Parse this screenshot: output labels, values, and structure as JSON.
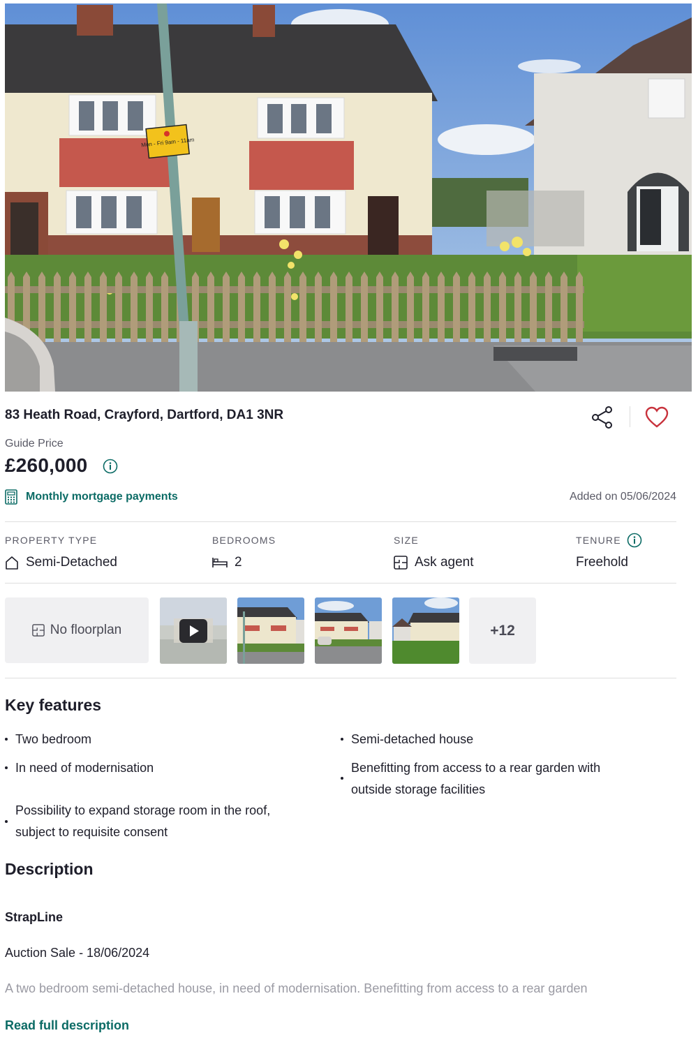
{
  "listing": {
    "address": "83 Heath Road, Crayford, Dartford, DA1 3NR",
    "price_label": "Guide Price",
    "price": "£260,000",
    "mortgage_link": "Monthly mortgage payments",
    "added_on": "Added on 05/06/2024",
    "sign_text": "Mon - Fri 9am - 11am"
  },
  "stats": [
    {
      "label": "PROPERTY TYPE",
      "value": "Semi-Detached",
      "icon": "house-icon"
    },
    {
      "label": "BEDROOMS",
      "value": "2",
      "icon": "bed-icon"
    },
    {
      "label": "SIZE",
      "value": "Ask agent",
      "icon": "floorplan-icon"
    },
    {
      "label": "TENURE",
      "value": "Freehold",
      "icon": "info-icon"
    }
  ],
  "media": {
    "floorplan_label": "No floorplan",
    "more_label": "+12"
  },
  "key_features": {
    "heading": "Key features",
    "items": [
      "Two bedroom",
      "Semi-detached house",
      "In need of modernisation",
      "Benefitting from access to a rear garden with outside storage facilities",
      "Possibility to expand storage room in the roof, subject to requisite consent"
    ]
  },
  "description": {
    "heading": "Description",
    "strapline": "StrapLine",
    "auction": "Auction Sale - 18/06/2024",
    "excerpt": "A two bedroom semi-detached house, in need of modernisation. Benefitting from access to a rear garden",
    "read_more": "Read full description"
  },
  "colors": {
    "accent": "#0b6b65",
    "favourite": "#c8323c",
    "text": "#1e1e2a",
    "muted": "#5a5a66"
  }
}
